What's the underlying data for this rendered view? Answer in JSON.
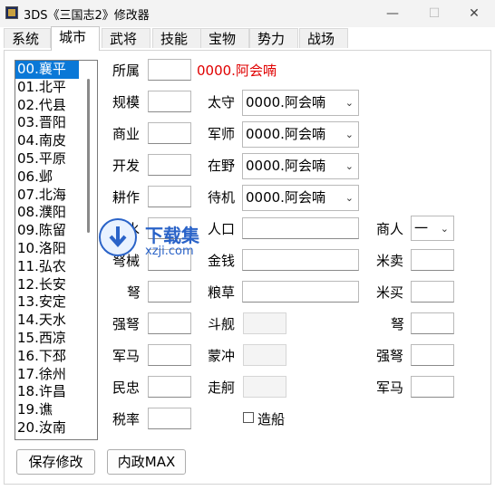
{
  "window": {
    "title": "3DS《三国志2》修改器",
    "minimize": "—",
    "maximize": "☐",
    "close": "✕"
  },
  "tabs": [
    "系统",
    "城市",
    "武将",
    "技能",
    "宝物",
    "势力",
    "战场"
  ],
  "city_list": [
    "00.襄平",
    "01.北平",
    "02.代县",
    "03.晋阳",
    "04.南皮",
    "05.平原",
    "06.邺",
    "07.北海",
    "08.濮阳",
    "09.陈留",
    "10.洛阳",
    "11.弘农",
    "12.长安",
    "13.安定",
    "14.天水",
    "15.西凉",
    "16.下邳",
    "17.徐州",
    "18.许昌",
    "19.谯",
    "20.汝南"
  ],
  "left_fields": {
    "suoshu": "所属",
    "guimo": "规模",
    "shangye": "商业",
    "kaifa": "开发",
    "gengzuo": "耕作",
    "lishui": "治水",
    "jiangxie": "弩械",
    "nu": "弩",
    "qiangnu": "强弩",
    "junma": "军马",
    "minzhong": "民忠",
    "shuilv": "税率"
  },
  "owner_value": "0000.阿会喃",
  "mid_fields": {
    "taishou": "太守",
    "junshi": "军师",
    "zaiye": "在野",
    "daiji": "待机",
    "renkou": "人口",
    "jinqian": "金钱",
    "liangcao": "粮草",
    "doujian": "斗舰",
    "mengchong": "蒙冲",
    "zouge": "走舸"
  },
  "combo_values": {
    "taishou": "0000.阿会喃",
    "junshi": "0000.阿会喃",
    "zaiye": "0000.阿会喃",
    "daiji": "0000.阿会喃"
  },
  "right_fields": {
    "shangren": "商人",
    "shangren_value": "一",
    "mimai": "米卖",
    "mimai2": "米买",
    "nu": "弩",
    "qiangnu": "强弩",
    "junma": "军马"
  },
  "checkbox": {
    "label": "造船"
  },
  "buttons": {
    "save": "保存修改",
    "neizheng": "内政MAX"
  },
  "watermark": {
    "main": "下载集",
    "sub": "xzji.com"
  }
}
